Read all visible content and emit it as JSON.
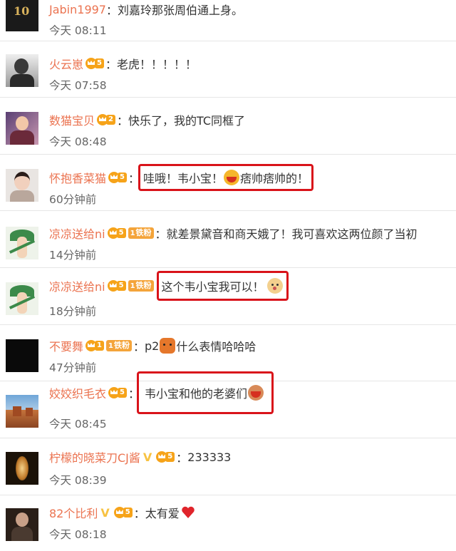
{
  "comments": [
    {
      "user": "Jabin1997",
      "text": "刘嘉玲那张周伯通上身。",
      "time": "今天 08:11",
      "avatar_text": "10"
    },
    {
      "user": "火云崽",
      "vip_level": "5",
      "text": "老虎！！！！！",
      "time": "今天 07:58"
    },
    {
      "user": "数猫宝贝",
      "vip_level": "2",
      "text": "快乐了，我的TC同框了",
      "time": "今天 08:48"
    },
    {
      "user": "怀抱香菜猫",
      "vip_level": "5",
      "text_a": "哇哦！韦小宝！",
      "text_b": "痞帅痞帅的！",
      "time": "60分钟前",
      "emoji": "laugh-emoji"
    },
    {
      "user": "凉凉送给ni",
      "vip_level": "5",
      "fan_level": "1",
      "fan_label": "铁粉",
      "text": "就差景黛音和商天娥了！我可喜欢这两位颜了当初",
      "time": "14分钟前"
    },
    {
      "user": "凉凉送给ni",
      "vip_level": "5",
      "fan_level": "1",
      "fan_label": "铁粉",
      "text": "这个韦小宝我可以！",
      "time": "18分钟前",
      "emoji": "doge-emoji"
    },
    {
      "user": "不要舞",
      "vip_level": "1",
      "fan_level": "1",
      "fan_label": "铁粉",
      "text_a": "p2",
      "text_b": "什么表情哈哈哈",
      "time": "47分钟前",
      "emoji": "tiger-emoji"
    },
    {
      "user": "姣姣织毛衣",
      "vip_level": "5",
      "text": "韦小宝和他的老婆们",
      "time": "今天 08:45",
      "emoji": "open-mouth-emoji"
    },
    {
      "user": "柠檬的晓菜刀CJ酱",
      "verified": "V",
      "vip_level": "5",
      "text": "233333",
      "time": "今天 08:39"
    },
    {
      "user": "82个比利",
      "verified": "V",
      "vip_level": "5",
      "text": "太有爱",
      "time": "今天 08:18",
      "emoji": "heart-emoji"
    }
  ],
  "colors": {
    "username": "#eb7350",
    "highlight_border": "#d9131a",
    "vip": "#f6a319",
    "text": "#333333",
    "time": "#666666"
  }
}
